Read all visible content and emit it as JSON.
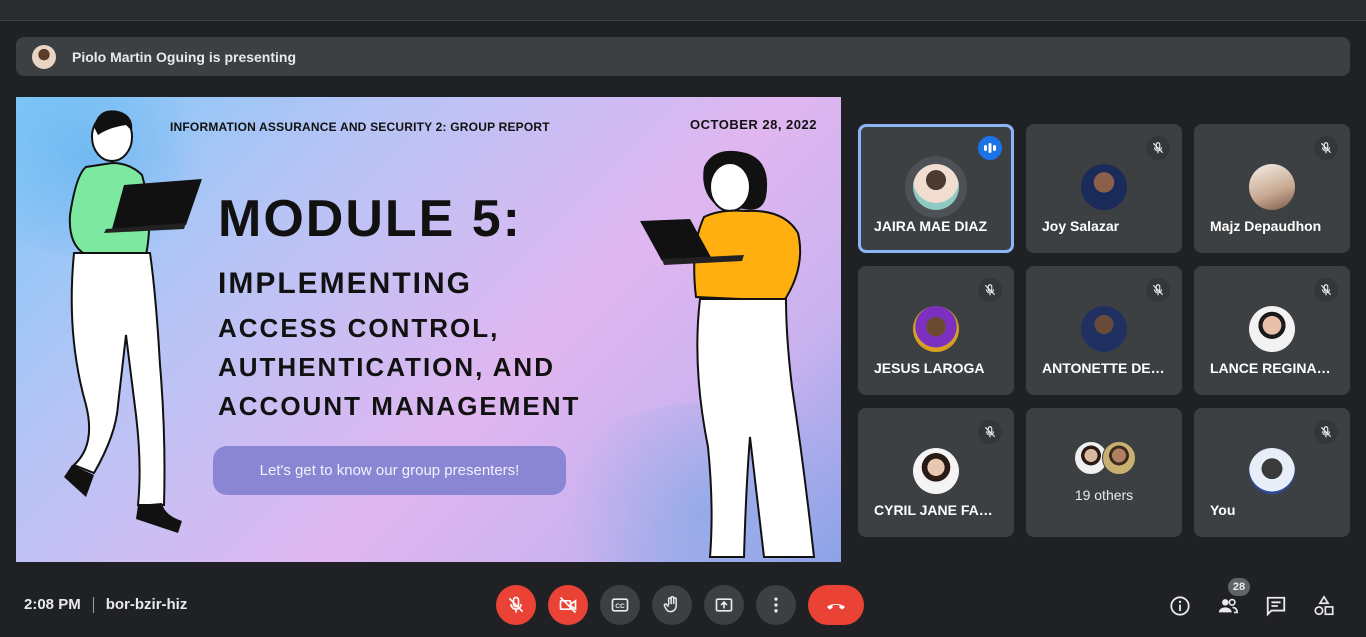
{
  "presenting": {
    "text": "Piolo Martin Oguing is presenting"
  },
  "slide": {
    "header": "INFORMATION ASSURANCE AND SECURITY 2:  GROUP REPORT",
    "date": "OCTOBER 28, 2022",
    "title": "MODULE 5:",
    "subtitle_lines": [
      "IMPLEMENTING",
      "ACCESS CONTROL,",
      "AUTHENTICATION, AND",
      "ACCOUNT MANAGEMENT"
    ],
    "cta": "Let's get to know our group presenters!"
  },
  "participants": [
    {
      "name": "JAIRA MAE DIAZ",
      "speaking": true,
      "muted": false
    },
    {
      "name": "Joy Salazar",
      "muted": true
    },
    {
      "name": "Majz Depaudhon",
      "muted": true
    },
    {
      "name": "JESUS LAROGA",
      "muted": true
    },
    {
      "name": "ANTONETTE DEL...",
      "muted": true
    },
    {
      "name": "LANCE REGINAL...",
      "muted": true
    },
    {
      "name": "CYRIL JANE FAB...",
      "muted": true
    },
    {
      "name": "19 others"
    },
    {
      "name": "You",
      "muted": true
    }
  ],
  "meeting": {
    "time": "2:08 PM",
    "code": "bor-bzir-hiz"
  },
  "people_count": "28",
  "colors": {
    "accent": "#8ab4f8",
    "danger": "#ea4335",
    "tile": "#3c4043",
    "bg": "#202124"
  },
  "controls": [
    "mic-off-icon",
    "camera-off-icon",
    "captions-icon",
    "raise-hand-icon",
    "present-icon",
    "more-options-icon",
    "end-call-icon"
  ],
  "right_icons": [
    "info-icon",
    "people-icon",
    "chat-icon",
    "activities-icon"
  ]
}
